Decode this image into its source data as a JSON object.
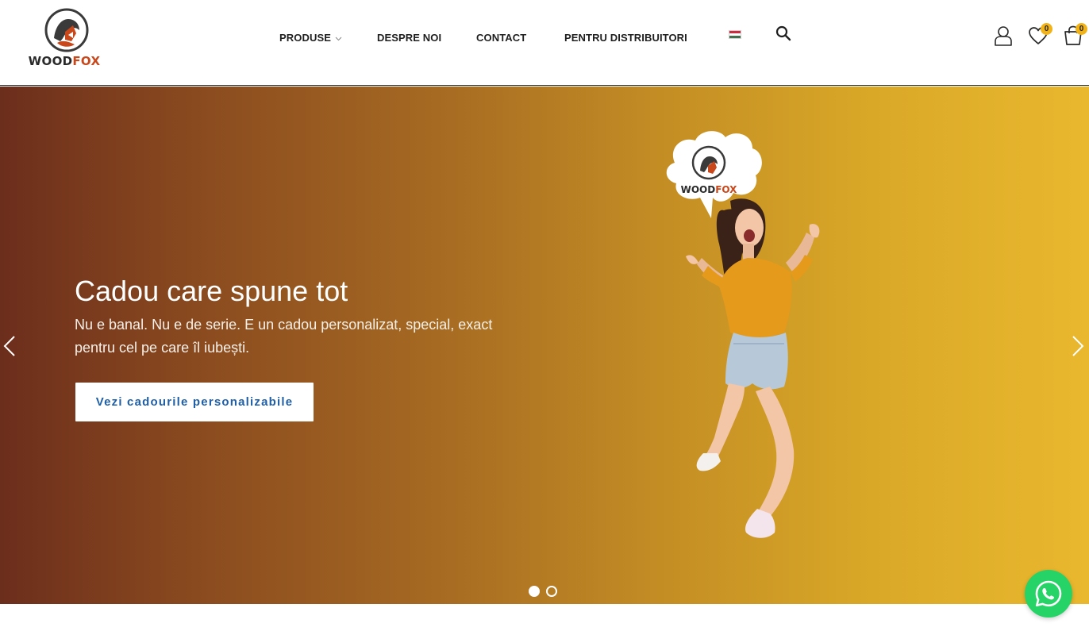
{
  "brand": {
    "logo_text_wood": "WOOD",
    "logo_text_fox": "FOX",
    "colors": {
      "primary_orange": "#c8481c",
      "accent_yellow": "#f2b318",
      "link_blue": "#1f5fa8"
    }
  },
  "nav": {
    "items": [
      {
        "label": "PRODUSE",
        "has_dropdown": true
      },
      {
        "label": "DESPRE NOI"
      },
      {
        "label": "CONTACT"
      },
      {
        "label": "PENTRU DISTRIBUITORI"
      }
    ],
    "language_flag": "hungary-flag-icon",
    "search_icon": "search-icon"
  },
  "header_actions": {
    "account_icon": "user-icon",
    "wishlist_icon": "heart-icon",
    "wishlist_count": "0",
    "cart_icon": "cart-icon",
    "cart_count": "0"
  },
  "hero": {
    "title": "Cadou care spune tot",
    "subtitle": "Nu e banal. Nu e de serie. E un cadou personalizat, special, exact pentru cel pe care îl iubești.",
    "button_label": "Vezi cadourile personalizabile",
    "bubble_logo_wood": "WOOD",
    "bubble_logo_fox": "FOX",
    "slides_total": 2,
    "active_slide": 1
  },
  "floating": {
    "whatsapp_icon": "whatsapp-icon"
  }
}
